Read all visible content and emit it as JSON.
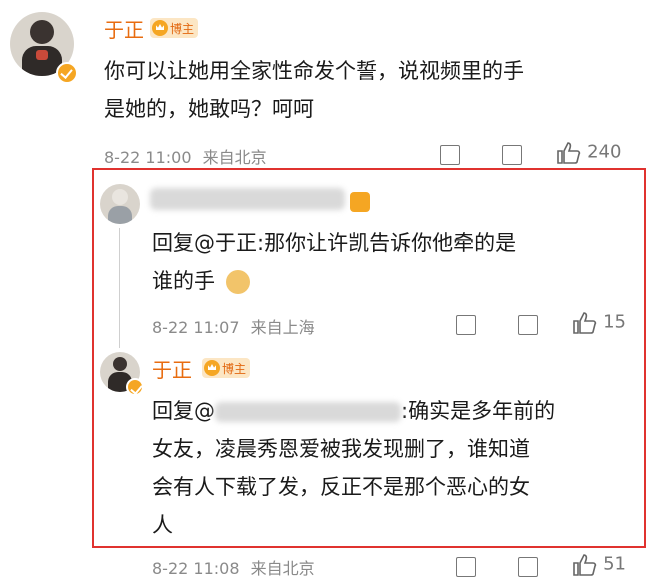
{
  "comment": {
    "username": "于正",
    "badge": "博主",
    "text_line1": "你可以让她用全家性命发个誓，说视频里的手",
    "text_line2": "是她的，她敢吗？呵呵",
    "time": "8-22 11:00",
    "location": "来自北京",
    "likes": "240"
  },
  "reply1": {
    "username": "",
    "text_line1": "回复@于正:那你让许凯告诉你他牵的是",
    "text_line2": "谁的手",
    "time": "8-22 11:07",
    "location": "来自上海",
    "likes": "15"
  },
  "reply2": {
    "username": "于正",
    "badge": "博主",
    "text_prefix": "回复@",
    "text_suffix": ":确实是多年前的",
    "text_line2": "女友，凌晨秀恩爱被我发现删了，谁知道",
    "text_line3": "会有人下载了发，反正不是那个恶心的女",
    "text_line4": "人",
    "time": "8-22 11:08",
    "location": "来自北京",
    "likes": "51"
  },
  "colors": {
    "name": "#e86c10",
    "highlight_border": "#e0322f",
    "meta": "#8a8a8a"
  }
}
